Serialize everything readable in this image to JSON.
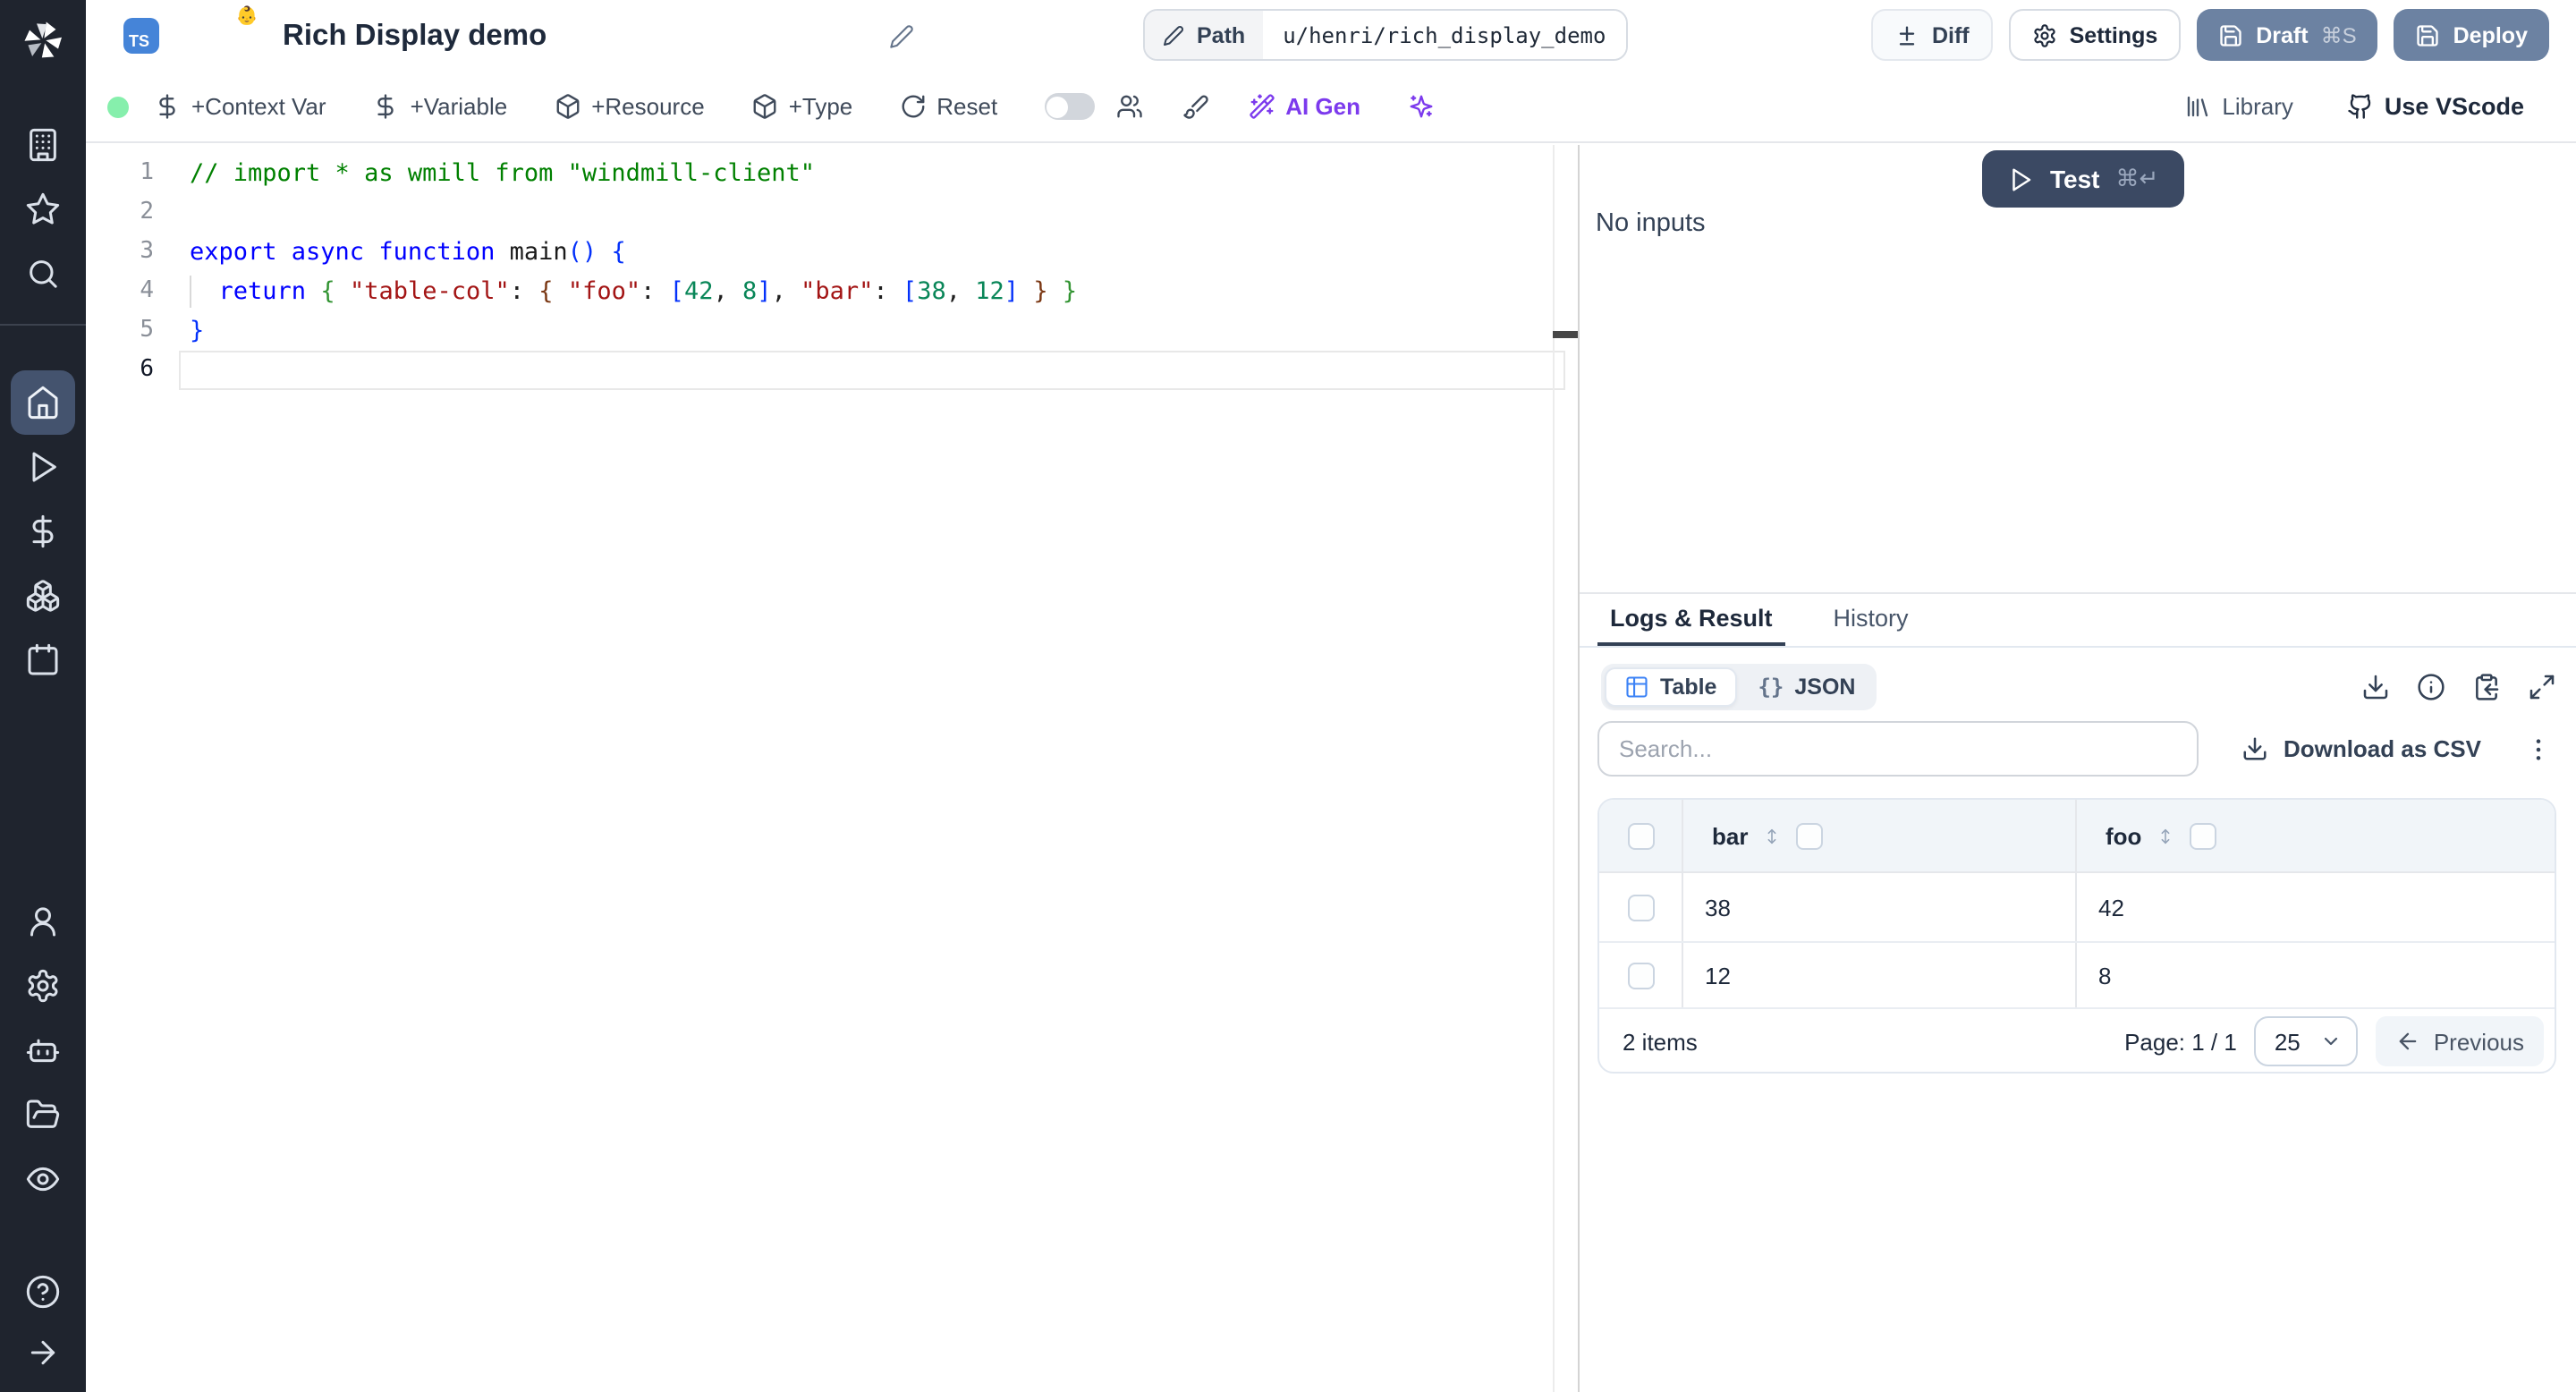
{
  "app": {
    "name": "Windmill script editor"
  },
  "sidebar": {
    "top": [
      {
        "icon": "building"
      },
      {
        "icon": "star"
      },
      {
        "icon": "search"
      }
    ],
    "main": [
      {
        "icon": "home",
        "active": true
      },
      {
        "icon": "play"
      },
      {
        "icon": "dollar"
      },
      {
        "icon": "boxes"
      },
      {
        "icon": "calendar"
      }
    ],
    "mid": [
      {
        "icon": "user"
      },
      {
        "icon": "settings"
      },
      {
        "icon": "robot"
      },
      {
        "icon": "folder-open"
      },
      {
        "icon": "eye"
      }
    ],
    "bottom": [
      {
        "icon": "help"
      },
      {
        "icon": "arrow-right"
      }
    ]
  },
  "header": {
    "language_badge": "TS",
    "badge_emoji": "👶",
    "title": "Rich Display demo",
    "path_label": "Path",
    "path_value": "u/henri/rich_display_demo",
    "diff_label": "Diff",
    "settings_label": "Settings",
    "draft_label": "Draft",
    "draft_shortcut": "⌘S",
    "deploy_label": "Deploy",
    "button_color": "#6c82a2"
  },
  "toolbar": {
    "status_color": "#86efac",
    "add_context_var": "+Context Var",
    "add_variable": "+Variable",
    "add_resource": "+Resource",
    "add_type": "+Type",
    "reset": "Reset",
    "ai_gen": "AI Gen",
    "ai_accent": "#7c3aed",
    "library": "Library",
    "use_vscode": "Use VScode"
  },
  "editor": {
    "language": "typescript",
    "lines": [
      {
        "tokens": [
          [
            "cm",
            "// import * as wmill from \"windmill-client\""
          ]
        ]
      },
      {
        "tokens": []
      },
      {
        "tokens": [
          [
            "kw",
            "export async function "
          ],
          [
            "id",
            "main"
          ],
          [
            "b1",
            "()"
          ],
          [
            "pl",
            " "
          ],
          [
            "b1",
            "{"
          ]
        ]
      },
      {
        "tokens": [
          [
            "pl",
            "  "
          ],
          [
            "kw",
            "return"
          ],
          [
            "pl",
            " "
          ],
          [
            "b2",
            "{"
          ],
          [
            "pl",
            " "
          ],
          [
            "str",
            "\"table-col\""
          ],
          [
            "pl",
            ": "
          ],
          [
            "b3",
            "{"
          ],
          [
            "pl",
            " "
          ],
          [
            "str",
            "\"foo\""
          ],
          [
            "pl",
            ": "
          ],
          [
            "b1",
            "["
          ],
          [
            "num",
            "42"
          ],
          [
            "pl",
            ", "
          ],
          [
            "num",
            "8"
          ],
          [
            "b1",
            "]"
          ],
          [
            "pl",
            ", "
          ],
          [
            "str",
            "\"bar\""
          ],
          [
            "pl",
            ": "
          ],
          [
            "b1",
            "["
          ],
          [
            "num",
            "38"
          ],
          [
            "pl",
            ", "
          ],
          [
            "num",
            "12"
          ],
          [
            "b1",
            "]"
          ],
          [
            "pl",
            " "
          ],
          [
            "b3",
            "}"
          ],
          [
            "pl",
            " "
          ],
          [
            "b2",
            "}"
          ]
        ],
        "indent_guide": true
      },
      {
        "tokens": [
          [
            "b1",
            "}"
          ]
        ]
      },
      {
        "tokens": [],
        "current": true
      }
    ]
  },
  "run_panel": {
    "test_label": "Test",
    "test_shortcut": "⌘↵",
    "test_color": "#3b4963",
    "no_inputs": "No inputs"
  },
  "result_panel": {
    "tabs": [
      {
        "label": "Logs & Result",
        "active": true
      },
      {
        "label": "History"
      }
    ],
    "view_toggle": [
      {
        "label": "Table",
        "icon": "table",
        "active": true
      },
      {
        "label": "JSON",
        "icon": "braces"
      }
    ],
    "toolbar_icons": [
      "download",
      "info",
      "clipboard-copy",
      "maximize"
    ],
    "search_placeholder": "Search...",
    "download_csv": "Download as CSV",
    "table": {
      "columns": [
        "bar",
        "foo"
      ],
      "rows": [
        [
          "38",
          "42"
        ],
        [
          "12",
          "8"
        ]
      ],
      "items_label": "2 items",
      "page_label": "Page: 1 / 1",
      "page_size": "25",
      "previous_label": "Previous"
    }
  }
}
